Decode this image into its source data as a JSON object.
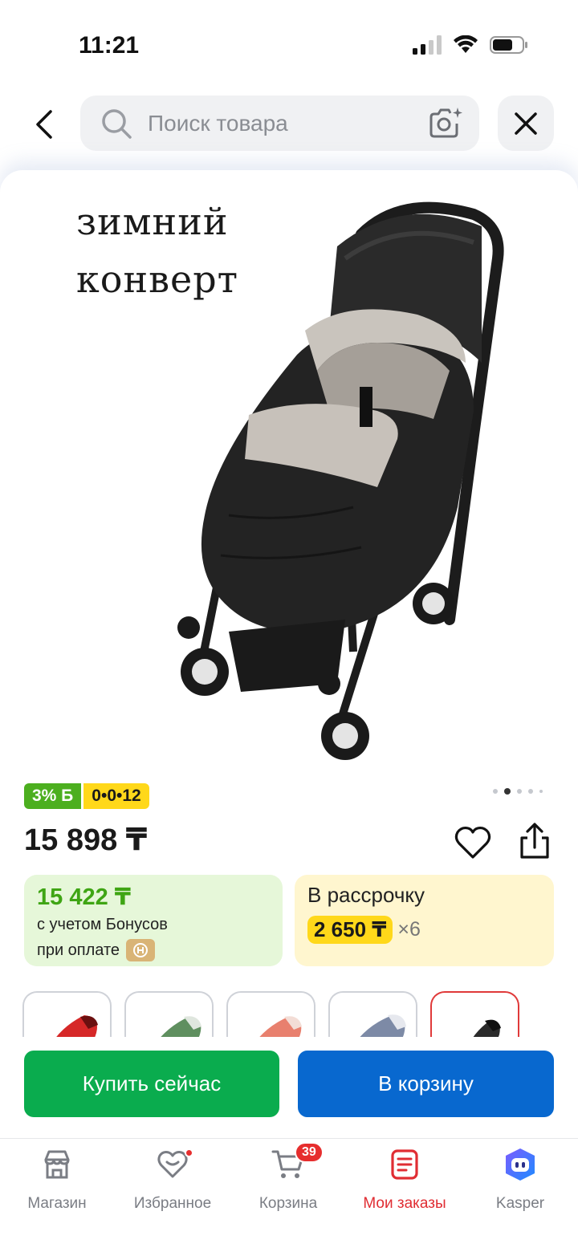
{
  "status_bar": {
    "time": "11:21"
  },
  "search": {
    "placeholder": "Поиск товара"
  },
  "product": {
    "image_caption_line1": "зимний",
    "image_caption_line2": "конверт",
    "bonus_badge": "3% Б",
    "installment_badge": "0•0•12",
    "price": "15 898 ₸",
    "gallery_pages": 5,
    "gallery_active_index": 2,
    "bonus_box": {
      "price": "15 422 ₸",
      "line1": "с учетом Бонусов",
      "line2": "при оплате"
    },
    "installment_box": {
      "title": "В рассрочку",
      "amount": "2 650 ₸",
      "multiplier": "×6"
    },
    "variants": [
      {
        "color": "#d62828",
        "selected": false
      },
      {
        "color": "#5f8f5f",
        "selected": false
      },
      {
        "color": "#e8806e",
        "selected": false
      },
      {
        "color": "#7d8aa6",
        "selected": false
      },
      {
        "color": "#2b2b2b",
        "selected": true
      }
    ]
  },
  "actions": {
    "buy_now": "Купить сейчас",
    "add_to_cart": "В корзину"
  },
  "bottom_nav": {
    "items": [
      {
        "label": "Магазин",
        "icon": "store-icon",
        "active": false
      },
      {
        "label": "Избранное",
        "icon": "heart-icon",
        "active": false
      },
      {
        "label": "Корзина",
        "icon": "cart-icon",
        "active": false,
        "badge": "39"
      },
      {
        "label": "Мои заказы",
        "icon": "orders-icon",
        "active": true
      },
      {
        "label": "Kasper",
        "icon": "kasper-assistant-icon",
        "active": false
      }
    ]
  },
  "colors": {
    "accent_red": "#e02d33",
    "buy_green": "#0aac4e",
    "cart_blue": "#0868cf",
    "bonus_green": "#4caf1f",
    "installment_yellow": "#ffd81a"
  }
}
